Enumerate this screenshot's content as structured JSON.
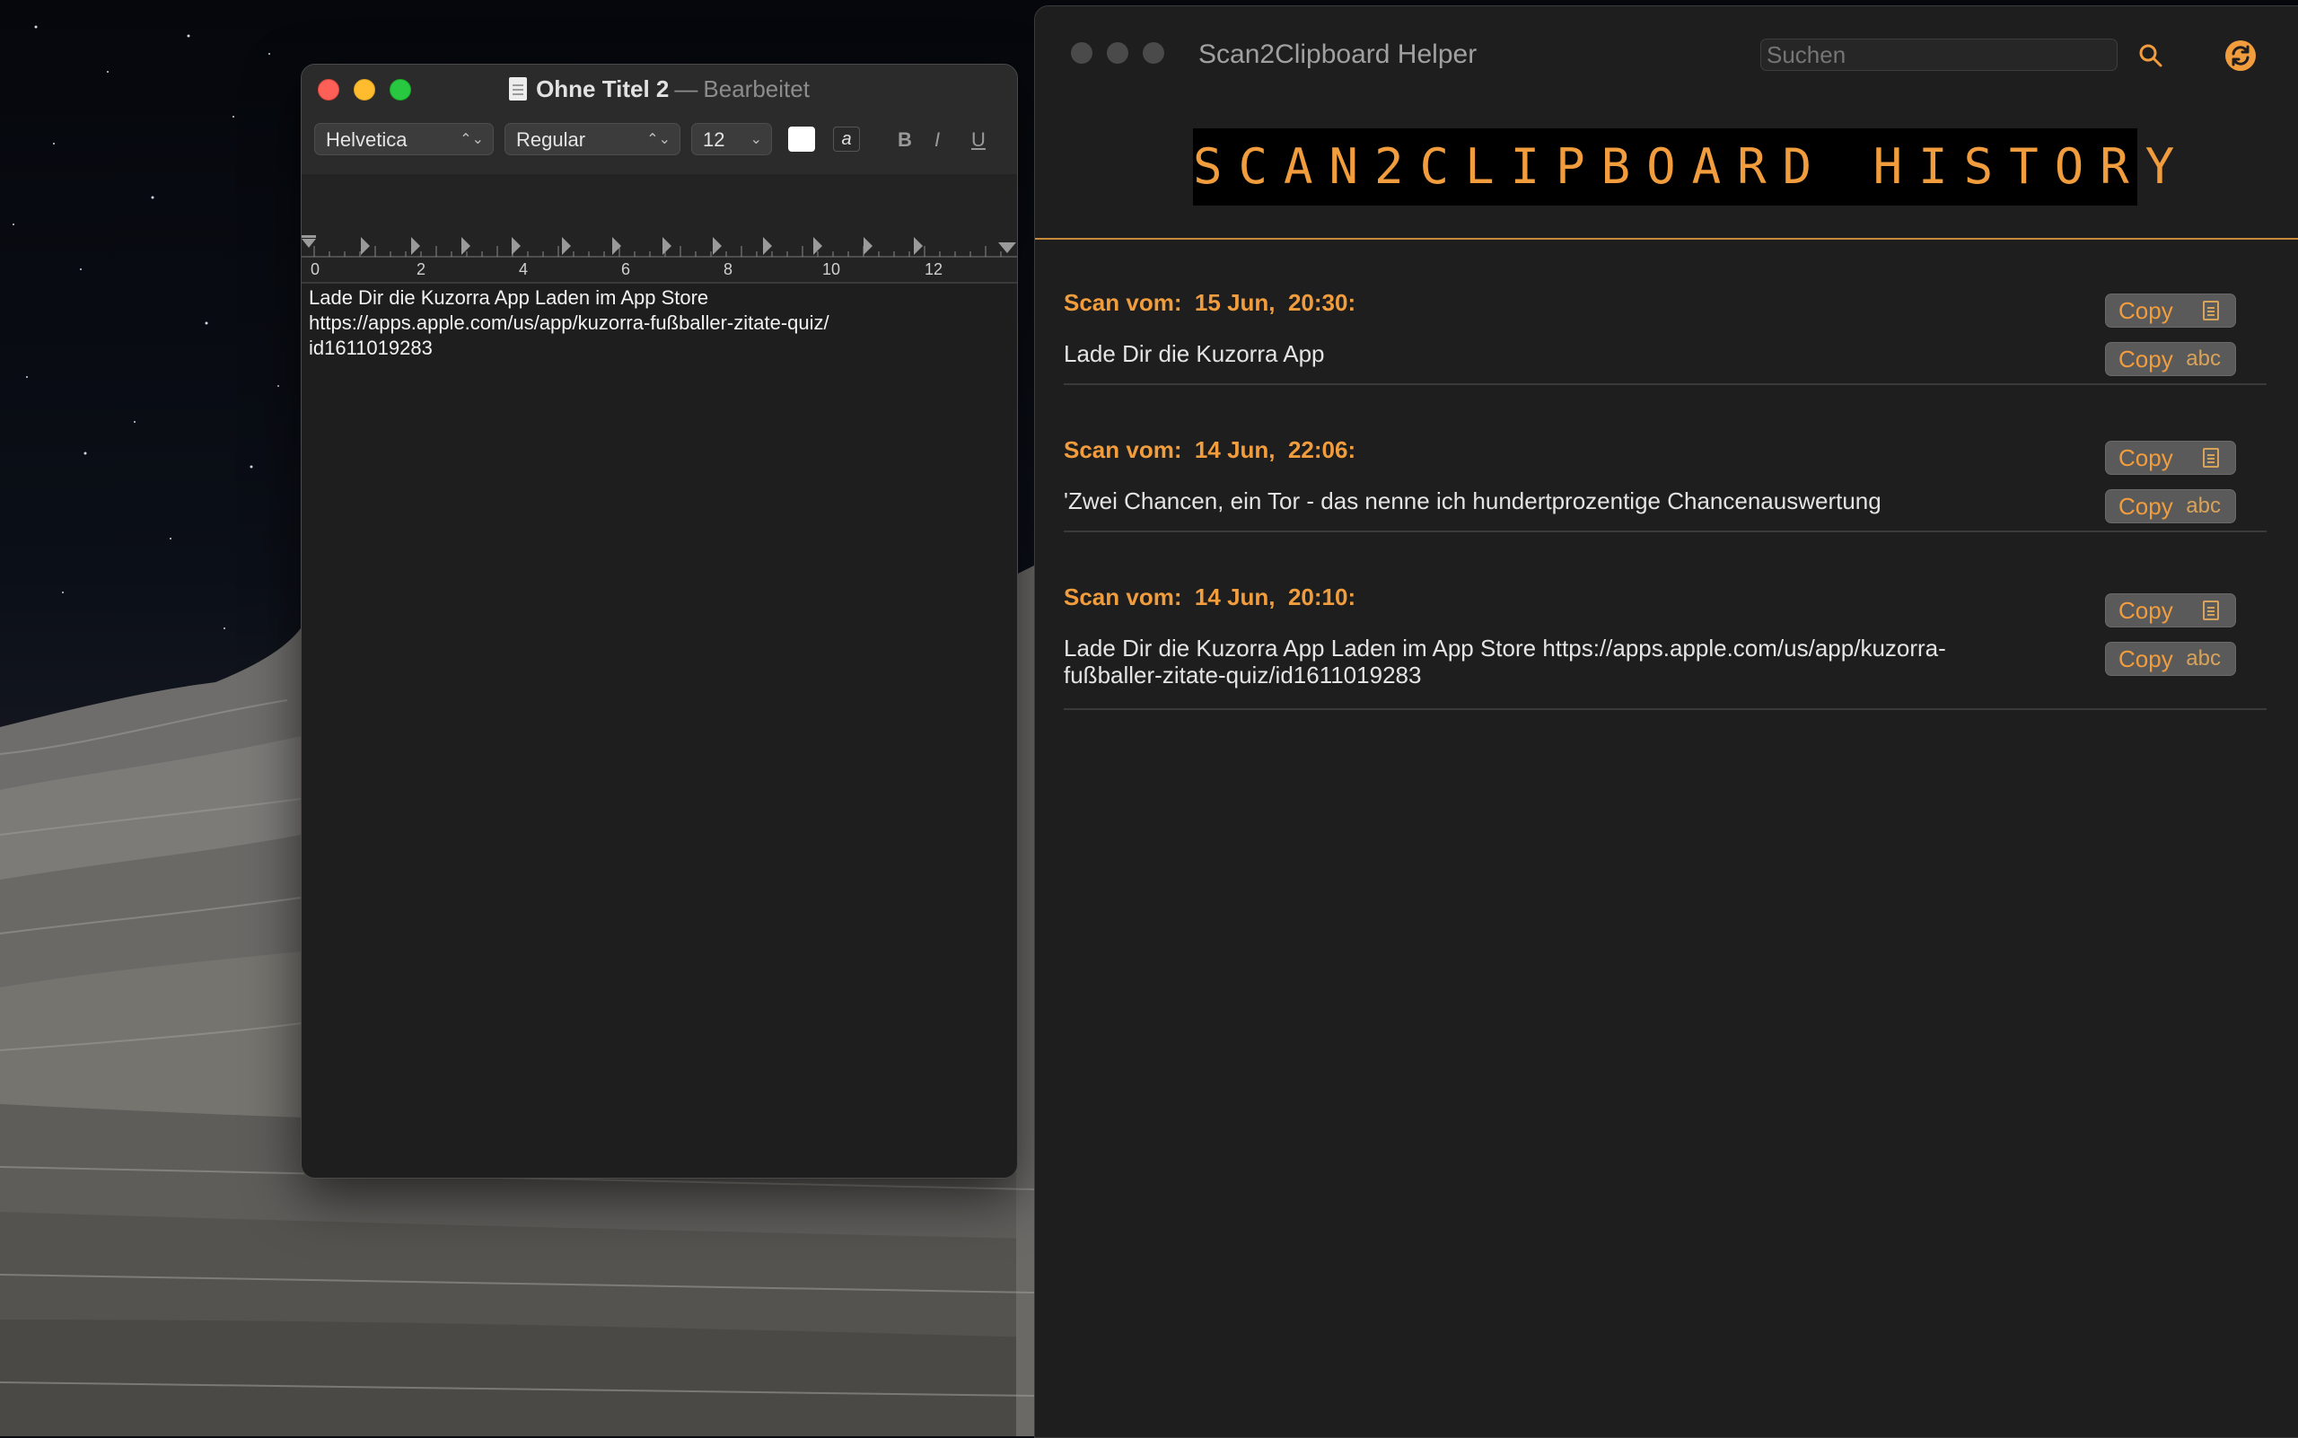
{
  "textedit": {
    "title": "Ohne Titel 2",
    "title_separator": "—",
    "status": "Bearbeitet",
    "toolbar": {
      "font_family": "Helvetica",
      "font_style": "Regular",
      "font_size": "12",
      "bold_label": "B",
      "italic_label": "I",
      "underline_label": "U",
      "text_color_label": "a"
    },
    "ruler_labels": [
      "0",
      "2",
      "4",
      "6",
      "8",
      "10",
      "12"
    ],
    "document_text": "Lade Dir die Kuzorra App Laden im App Store\nhttps://apps.apple.com/us/app/kuzorra-fußballer-zitate-quiz/\nid1611019283"
  },
  "scan2clipboard": {
    "title": "Scan2Clipboard Helper",
    "search": {
      "placeholder": "Suchen"
    },
    "banner": "SCAN2CLIPBOARD HISTORY",
    "copy_label": "Copy",
    "copy_text_suffix": "abc",
    "entries": [
      {
        "header": "Scan vom:  15 Jun,  20:30:",
        "text": "Lade Dir die Kuzorra App"
      },
      {
        "header": "Scan vom:  14 Jun,  22:06:",
        "text": "'Zwei Chancen, ein Tor - das nenne ich hundertprozentige Chancenauswertung"
      },
      {
        "header": "Scan vom:  14 Jun,  20:10:",
        "text": "Lade Dir die Kuzorra App Laden im App Store https://apps.apple.com/us/app/kuzorra-fußballer-zitate-quiz/id1611019283"
      }
    ]
  },
  "colors": {
    "accent_orange": "#f29d3d",
    "window_bg": "#1e1e1e",
    "text_light": "#e4e4e4"
  }
}
